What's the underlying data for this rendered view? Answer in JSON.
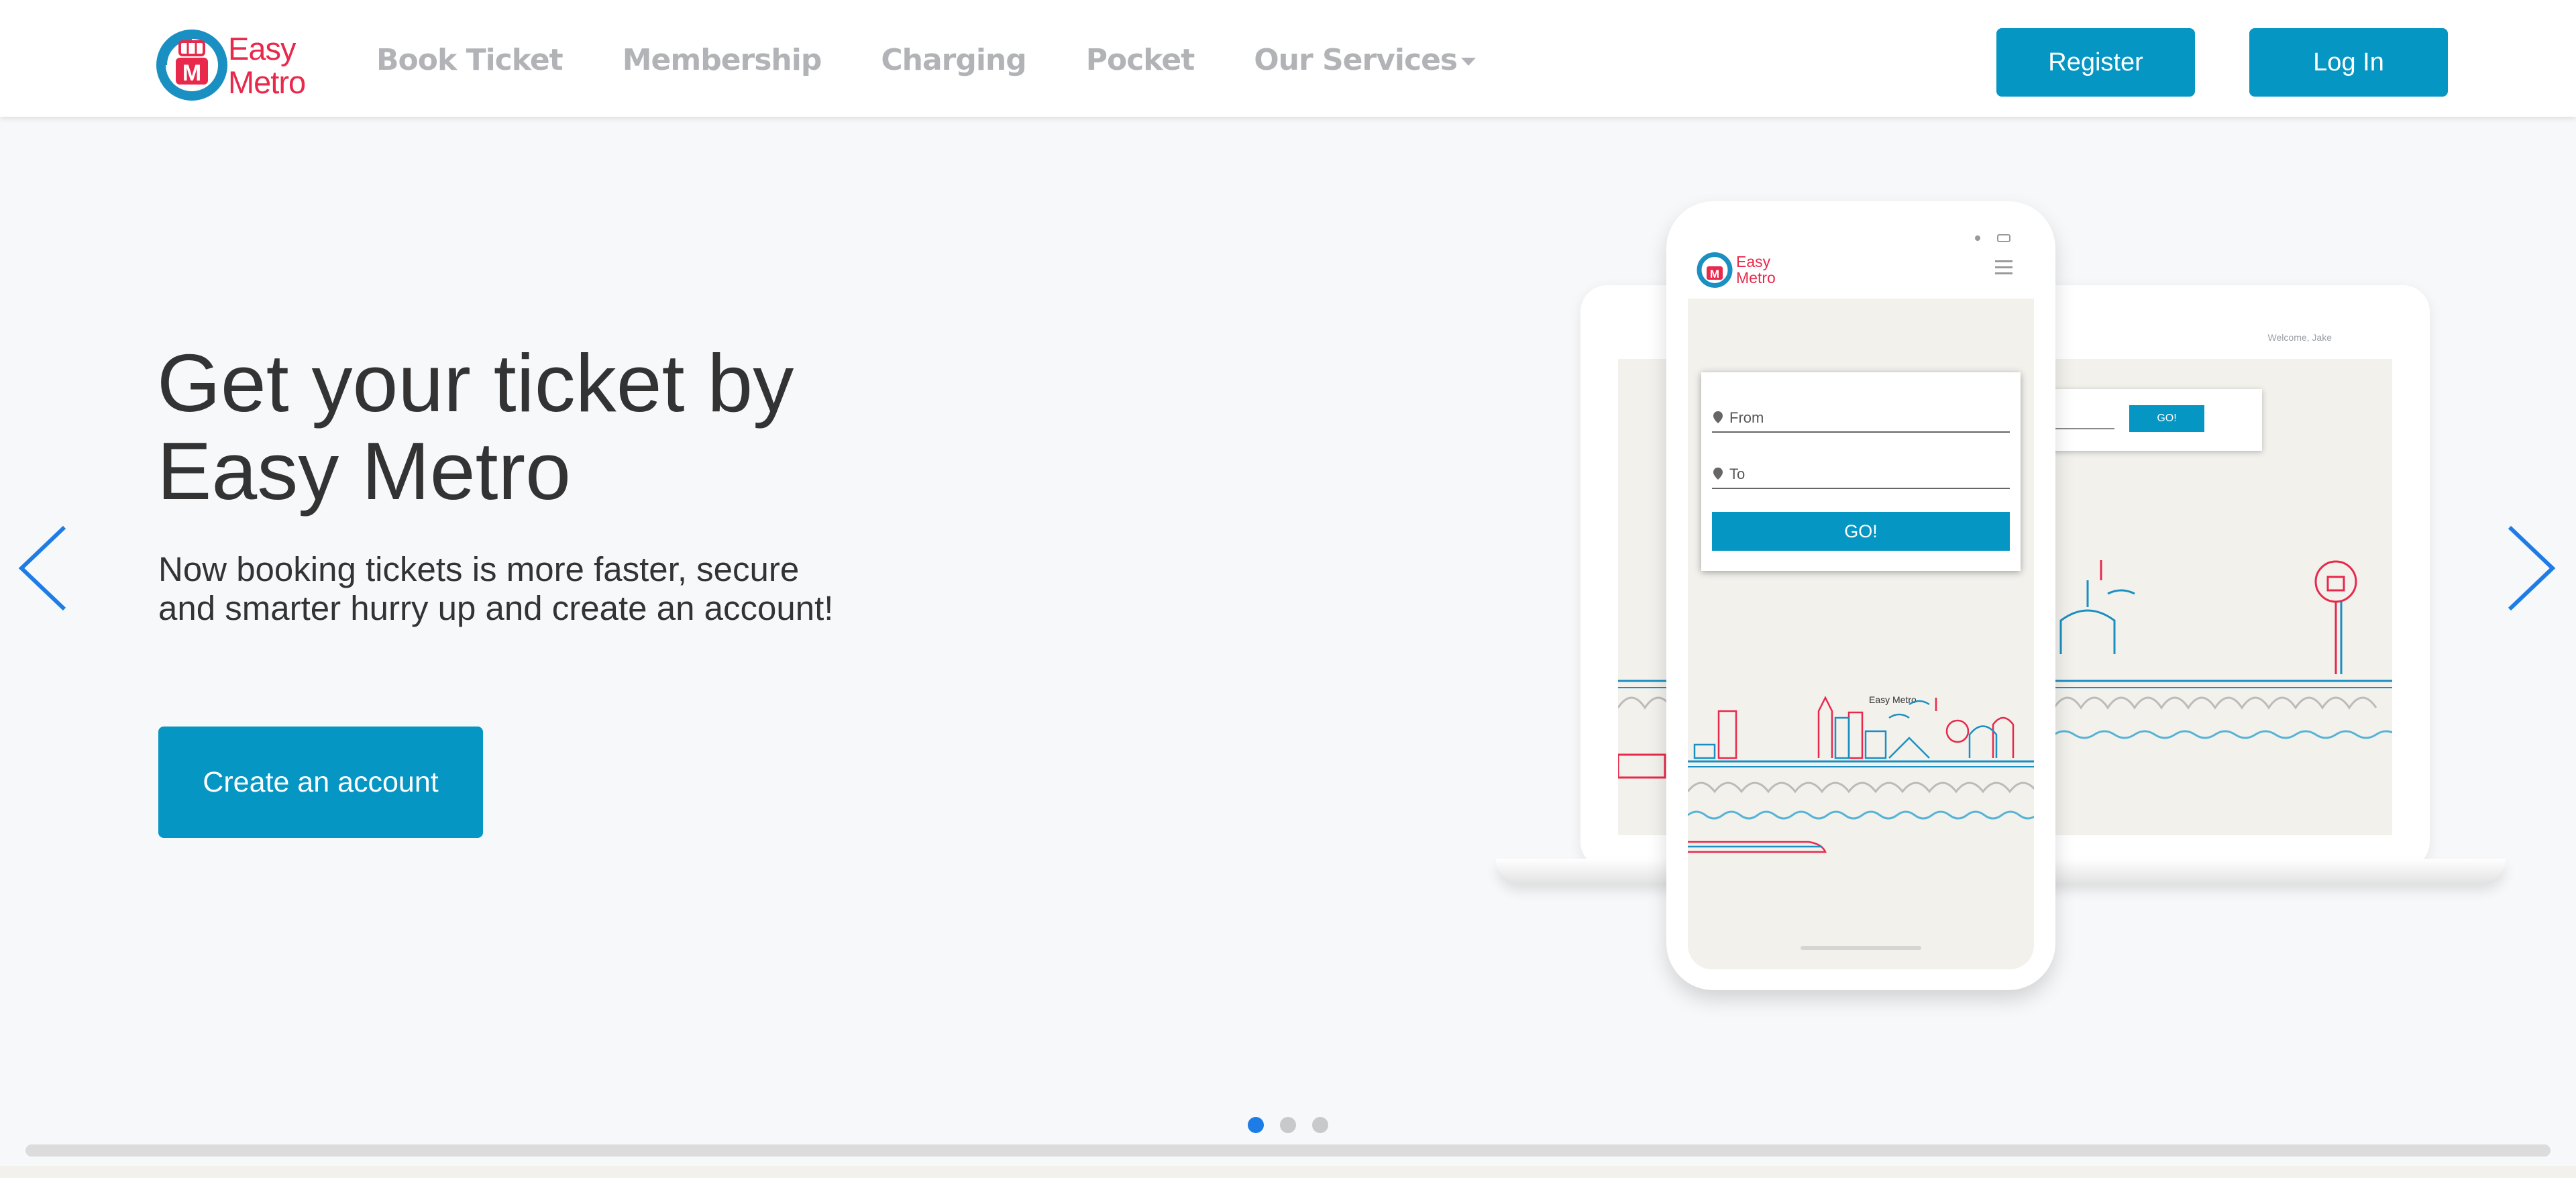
{
  "brand": {
    "logo_line1": "Easy",
    "logo_line2": "Metro",
    "brand_red": "#e8294b",
    "brand_blue": "#0596c3"
  },
  "nav": {
    "items": [
      {
        "label": "Book Ticket"
      },
      {
        "label": "Membership"
      },
      {
        "label": "Charging"
      },
      {
        "label": "Pocket"
      },
      {
        "label": "Our Services",
        "has_dropdown": true
      }
    ],
    "register_label": "Register",
    "login_label": "Log In"
  },
  "hero": {
    "title_line1": "Get your ticket by",
    "title_line2": "Easy Metro",
    "subtitle_line1": "Now booking tickets is more faster, secure",
    "subtitle_line2": "and smarter hurry up and create an account!",
    "cta_label": "Create an account"
  },
  "mockup": {
    "phone_logo_line1": "Easy",
    "phone_logo_line2": "Metro",
    "from_placeholder": "From",
    "to_placeholder": "To",
    "go_label": "GO!",
    "skyline_label": "Easy Metro",
    "laptop_welcome": "Welcome, Jake",
    "laptop_go_label": "GO!"
  },
  "carousel": {
    "slide_count": 3,
    "active_index": 0,
    "prev_icon": "chevron-left-icon",
    "next_icon": "chevron-right-icon",
    "active_color": "#1e7ce6"
  }
}
